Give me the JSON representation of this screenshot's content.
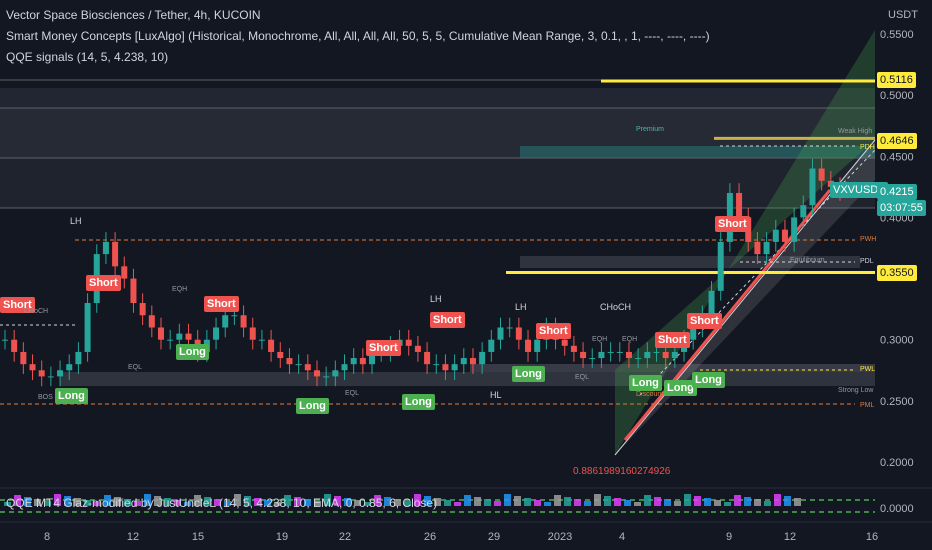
{
  "header": {
    "title": "Vector Space Biosciences / Tether, 4h, KUCOIN",
    "smc_indicator": "Smart Money Concepts [LuxAlgo] (Historical, Monochrome, All, All, All, All, 50, 5, 5, Cumulative Mean Range, 3, 0.1, , 1, ----, ----, ----)",
    "qqe_indicator": "QQE signals (14, 5, 4.238, 10)",
    "oscillator_label": "QQE MT4 Glaz-modified by JustUncleL (14, 5, 4.238, 10, EMA, 0, 0.85, 6, Close)"
  },
  "axis": {
    "currency": "USDT",
    "y_ticks": [
      "0.5500",
      "0.5000",
      "0.4500",
      "0.4000",
      "0.3000",
      "0.2500",
      "0.2000"
    ],
    "osc_tick": "0.0000",
    "x_ticks": [
      "8",
      "12",
      "15",
      "19",
      "22",
      "26",
      "29",
      "2023",
      "4",
      "9",
      "12",
      "16"
    ]
  },
  "price_tags": {
    "level_high": "0.5116",
    "level_mid": "0.4646",
    "symbol": "VXVUSDT",
    "last_price": "0.4215",
    "countdown": "03:07:55",
    "level_low": "0.3550"
  },
  "signals": {
    "short": "Short",
    "long": "Long"
  },
  "structure_labels": {
    "lh": "LH",
    "hl": "HL",
    "choch": "CHoCH",
    "eqh": "EQH",
    "eql": "EQL",
    "bos": "BOS",
    "pdh": "PDH",
    "pdl": "PDL",
    "pwh": "PWH",
    "pwl": "PWL",
    "pml": "PML",
    "weak_high": "Weak High",
    "strong_low": "Strong Low",
    "premium": "Premium",
    "equilibrium": "Equilibrium",
    "discount": "Discount",
    "fib_value": "0.8861989160274926"
  },
  "colors": {
    "background": "#131722",
    "up": "#26a69a",
    "down": "#ef5350",
    "yellow": "#ffeb3b",
    "pivot_dashed": "#e07b39",
    "channel": "#4caf50"
  },
  "chart_data": {
    "type": "candlestick",
    "title": "Vector Space Biosciences / Tether, 4h, KUCOIN",
    "ylabel": "USDT",
    "ylim": [
      0.15,
      0.57
    ],
    "last_price": 0.4215,
    "levels": [
      {
        "name": "yellow-high",
        "value": 0.5116
      },
      {
        "name": "yellow-mid",
        "value": 0.4646
      },
      {
        "name": "yellow-low",
        "value": 0.355
      },
      {
        "name": "pwh",
        "value": 0.378
      },
      {
        "name": "pdl",
        "value": 0.3615
      },
      {
        "name": "pwl",
        "value": 0.2765
      },
      {
        "name": "pml",
        "value": 0.2485
      }
    ],
    "x_ticks": [
      "8",
      "12",
      "15",
      "19",
      "22",
      "26",
      "29",
      "2023",
      "4",
      "9",
      "12",
      "16"
    ],
    "close_path": [
      0.3,
      0.29,
      0.28,
      0.275,
      0.27,
      0.27,
      0.275,
      0.28,
      0.29,
      0.33,
      0.37,
      0.38,
      0.36,
      0.35,
      0.33,
      0.32,
      0.31,
      0.3,
      0.3,
      0.305,
      0.3,
      0.29,
      0.3,
      0.31,
      0.32,
      0.32,
      0.31,
      0.3,
      0.3,
      0.29,
      0.285,
      0.28,
      0.28,
      0.275,
      0.27,
      0.27,
      0.275,
      0.28,
      0.285,
      0.28,
      0.29,
      0.29,
      0.295,
      0.3,
      0.295,
      0.29,
      0.28,
      0.28,
      0.275,
      0.28,
      0.285,
      0.28,
      0.29,
      0.3,
      0.31,
      0.31,
      0.3,
      0.29,
      0.3,
      0.31,
      0.3,
      0.295,
      0.29,
      0.285,
      0.285,
      0.29,
      0.29,
      0.29,
      0.285,
      0.285,
      0.29,
      0.29,
      0.285,
      0.29,
      0.3,
      0.31,
      0.32,
      0.34,
      0.38,
      0.42,
      0.4,
      0.38,
      0.37,
      0.38,
      0.39,
      0.38,
      0.4,
      0.41,
      0.44,
      0.43,
      0.425,
      0.4215
    ]
  }
}
